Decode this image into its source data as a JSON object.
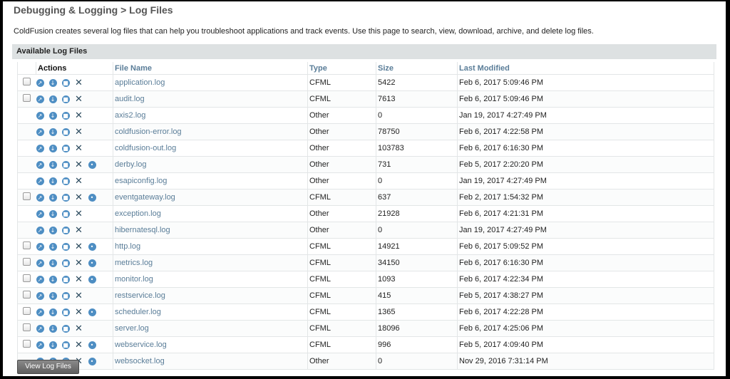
{
  "page": {
    "title": "Debugging & Logging > Log Files",
    "intro": "ColdFusion creates several log files that can help you troubleshoot applications and track events. Use this page to search, view, download, archive, and delete log files.",
    "section_title": "Available Log Files"
  },
  "table": {
    "headers": {
      "actions": "Actions",
      "file_name": "File Name",
      "type": "Type",
      "size": "Size",
      "last_modified": "Last Modified"
    },
    "rows": [
      {
        "file": "application.log",
        "type": "CFML",
        "size": "5422",
        "modified": "Feb 6, 2017 5:09:46 PM",
        "checkbox": true,
        "extra": false
      },
      {
        "file": "audit.log",
        "type": "CFML",
        "size": "7613",
        "modified": "Feb 6, 2017 5:09:46 PM",
        "checkbox": true,
        "extra": false
      },
      {
        "file": "axis2.log",
        "type": "Other",
        "size": "0",
        "modified": "Jan 19, 2017 4:27:49 PM",
        "checkbox": false,
        "extra": false
      },
      {
        "file": "coldfusion-error.log",
        "type": "Other",
        "size": "78750",
        "modified": "Feb 6, 2017 4:22:58 PM",
        "checkbox": false,
        "extra": false
      },
      {
        "file": "coldfusion-out.log",
        "type": "Other",
        "size": "103783",
        "modified": "Feb 6, 2017 6:16:30 PM",
        "checkbox": false,
        "extra": false
      },
      {
        "file": "derby.log",
        "type": "Other",
        "size": "731",
        "modified": "Feb 5, 2017 2:20:20 PM",
        "checkbox": false,
        "extra": true
      },
      {
        "file": "esapiconfig.log",
        "type": "Other",
        "size": "0",
        "modified": "Jan 19, 2017 4:27:49 PM",
        "checkbox": false,
        "extra": false
      },
      {
        "file": "eventgateway.log",
        "type": "CFML",
        "size": "637",
        "modified": "Feb 2, 2017 1:54:32 PM",
        "checkbox": true,
        "extra": true
      },
      {
        "file": "exception.log",
        "type": "Other",
        "size": "21928",
        "modified": "Feb 6, 2017 4:21:31 PM",
        "checkbox": false,
        "extra": false
      },
      {
        "file": "hibernatesql.log",
        "type": "Other",
        "size": "0",
        "modified": "Jan 19, 2017 4:27:49 PM",
        "checkbox": false,
        "extra": false
      },
      {
        "file": "http.log",
        "type": "CFML",
        "size": "14921",
        "modified": "Feb 6, 2017 5:09:52 PM",
        "checkbox": true,
        "extra": true
      },
      {
        "file": "metrics.log",
        "type": "CFML",
        "size": "34150",
        "modified": "Feb 6, 2017 6:16:30 PM",
        "checkbox": true,
        "extra": true
      },
      {
        "file": "monitor.log",
        "type": "CFML",
        "size": "1093",
        "modified": "Feb 6, 2017 4:22:34 PM",
        "checkbox": true,
        "extra": true
      },
      {
        "file": "restservice.log",
        "type": "CFML",
        "size": "415",
        "modified": "Feb 5, 2017 4:38:27 PM",
        "checkbox": true,
        "extra": false
      },
      {
        "file": "scheduler.log",
        "type": "CFML",
        "size": "1365",
        "modified": "Feb 6, 2017 4:22:28 PM",
        "checkbox": true,
        "extra": true
      },
      {
        "file": "server.log",
        "type": "CFML",
        "size": "18096",
        "modified": "Feb 6, 2017 4:25:06 PM",
        "checkbox": true,
        "extra": false
      },
      {
        "file": "webservice.log",
        "type": "CFML",
        "size": "996",
        "modified": "Feb 5, 2017 4:09:40 PM",
        "checkbox": true,
        "extra": true
      },
      {
        "file": "websocket.log",
        "type": "Other",
        "size": "0",
        "modified": "Nov 29, 2016 7:31:14 PM",
        "checkbox": false,
        "extra": true
      }
    ]
  },
  "icons": [
    "search-icon",
    "download-icon",
    "archive-icon",
    "delete-icon",
    "extra-icon"
  ],
  "buttons": {
    "view_log_files": "View Log Files"
  },
  "colors": {
    "link": "#5a7d98",
    "icon": "#4e8ec3",
    "section_bar": "#dde1e2"
  }
}
